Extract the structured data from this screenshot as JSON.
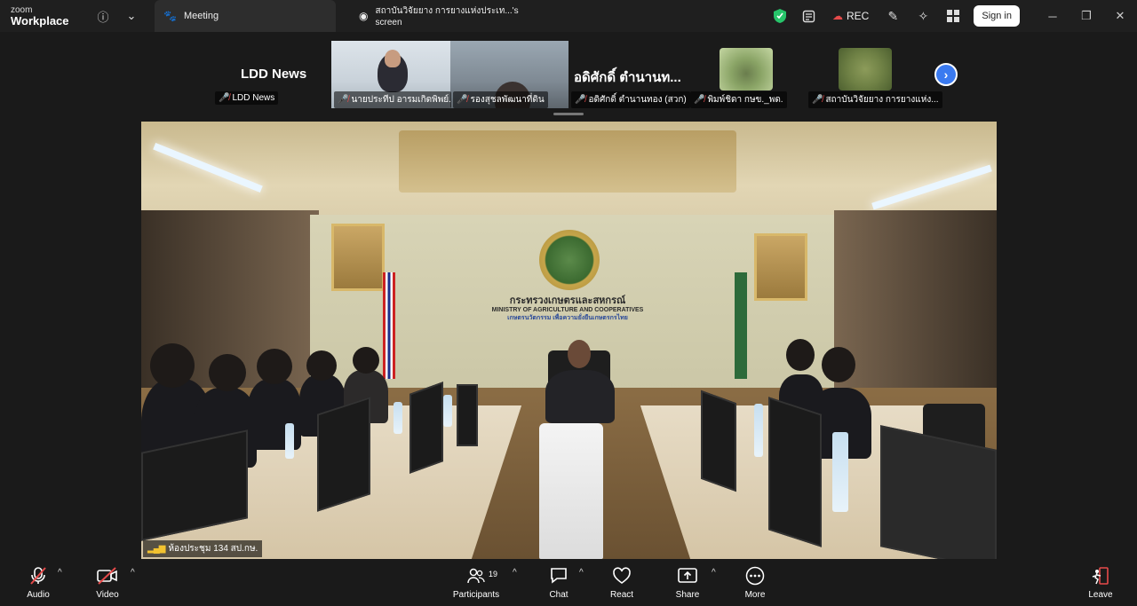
{
  "app": {
    "logo_line1": "zoom",
    "logo_line2": "Workplace"
  },
  "titlebar": {
    "info_icon": "info-icon",
    "chevron_icon": "chevron-down-icon",
    "tabs": [
      {
        "label": "Meeting",
        "icon": "paw-icon",
        "active": true
      },
      {
        "label": "สถาบันวิจัยยาง การยางแห่งประเท...'s screen",
        "icon": "avatar-icon",
        "active": false
      }
    ],
    "rec_label": "REC",
    "signin_label": "Sign in",
    "accent_green": "#27c46a",
    "rec_red": "#e64a4a"
  },
  "gallery": {
    "tiles": [
      {
        "big_name": "LDD News",
        "label": "LDD News"
      },
      {
        "label": "นายประทีป อารมเกิดพิพย์..."
      },
      {
        "label": "รองสุชลพัฒนาที่ดิน"
      },
      {
        "big_name": "อดิศักดิ์ ตำนานท...",
        "label": "อดิศักดิ์ ตำนานทอง (สวก)"
      },
      {
        "label": "พิมพ์ชิดา กษข._พด."
      },
      {
        "label": "สถาบันวิจัยยาง การยางแห่ง..."
      }
    ],
    "next_icon": "chevron-right-icon"
  },
  "main_video": {
    "wall_text_line1": "กระทรวงเกษตรและสหกรณ์",
    "wall_text_line2": "MINISTRY OF AGRICULTURE AND COOPERATIVES",
    "wall_text_line3": "เกษตรนวัตกรรม เพื่อความยั่งยืนเกษตรกรไทย",
    "speaker_label": "ห้องประชุม 134 สป.กษ."
  },
  "toolbar": {
    "audio_label": "Audio",
    "video_label": "Video",
    "participants_label": "Participants",
    "participants_count": "19",
    "chat_label": "Chat",
    "react_label": "React",
    "share_label": "Share",
    "more_label": "More",
    "leave_label": "Leave"
  }
}
